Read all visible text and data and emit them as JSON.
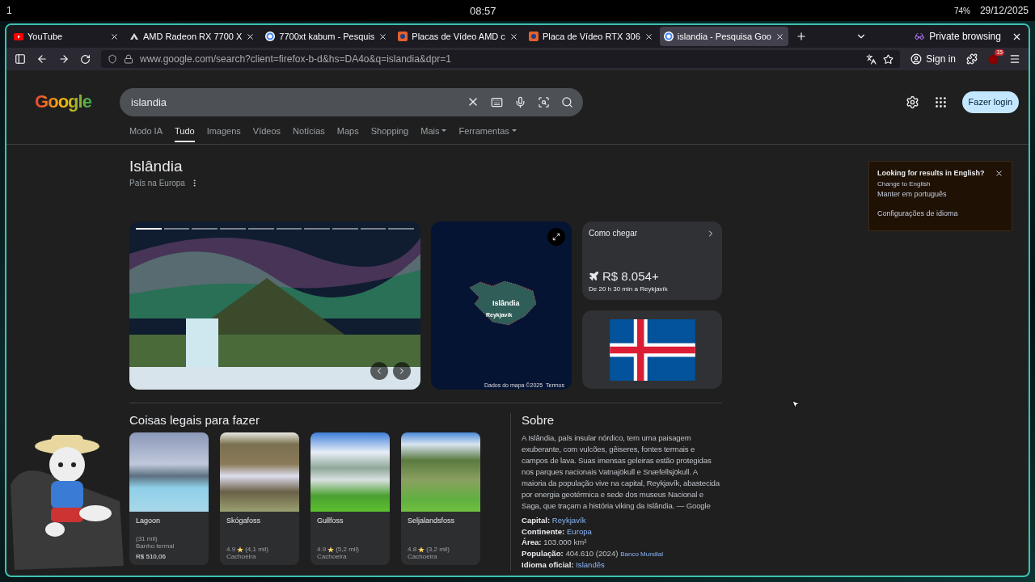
{
  "top_bar": {
    "workspace": "1",
    "clock": "08:57",
    "battery": "74%",
    "date": "29/12/2025"
  },
  "tabs": [
    {
      "title": "YouTube",
      "kind": "youtube",
      "selected": false
    },
    {
      "title": "AMD Radeon RX 7700 X",
      "kind": "amd",
      "selected": false
    },
    {
      "title": "7700xt kabum - Pesquis",
      "kind": "google",
      "selected": false
    },
    {
      "title": "Placas de Vídeo AMD c",
      "kind": "kabum",
      "selected": false
    },
    {
      "title": "Placa de Vídeo RTX 306",
      "kind": "kabum",
      "selected": false
    },
    {
      "title": "islandia - Pesquisa Goo",
      "kind": "google",
      "selected": true
    }
  ],
  "private_label": "Private browsing",
  "toolbar": {
    "url": "www.google.com/search?client=firefox-b-d&hs=DA4o&q=islandia&dpr=1",
    "sign_in": "Sign in",
    "extension_badge": "15"
  },
  "google": {
    "logo": "Google",
    "query": "islandia",
    "login": "Fazer login",
    "nav": [
      {
        "label": "Modo IA",
        "selected": false,
        "dropdown": false
      },
      {
        "label": "Tudo",
        "selected": true,
        "dropdown": false
      },
      {
        "label": "Imagens",
        "selected": false,
        "dropdown": false
      },
      {
        "label": "Vídeos",
        "selected": false,
        "dropdown": false
      },
      {
        "label": "Notícias",
        "selected": false,
        "dropdown": false
      },
      {
        "label": "Maps",
        "selected": false,
        "dropdown": false
      },
      {
        "label": "Shopping",
        "selected": false,
        "dropdown": false
      },
      {
        "label": "Mais",
        "selected": false,
        "dropdown": true
      },
      {
        "label": "Ferramentas",
        "selected": false,
        "dropdown": true
      }
    ]
  },
  "entity": {
    "title": "Islândia",
    "subtitle": "País na Europa",
    "carousel_dots": [
      {
        "selected": true
      },
      {
        "selected": false
      },
      {
        "selected": false
      },
      {
        "selected": false
      },
      {
        "selected": false
      },
      {
        "selected": false
      },
      {
        "selected": false
      },
      {
        "selected": false
      },
      {
        "selected": false
      },
      {
        "selected": false
      }
    ],
    "map": {
      "country": "Islândia",
      "city": "Reykjavík",
      "attribution": "Dados do mapa ©2025",
      "terms": "Termos"
    },
    "travel": {
      "title": "Como chegar",
      "price": "R$ 8.054+",
      "duration": "De 20 h 30 min a Reykjavík"
    }
  },
  "things_to_do": {
    "heading": "Coisas legais para fazer",
    "cards": [
      {
        "title": "Lagoon",
        "reviews": "(31 mil)",
        "category": "Banho termal",
        "price": "R$ 510,06"
      },
      {
        "title": "Skógafoss",
        "rating": "4.9",
        "reviews": "(4,1 mil)",
        "category": "Cachoeira"
      },
      {
        "title": "Gullfoss",
        "rating": "4.9",
        "reviews": "(5,2 mil)",
        "category": "Cachoeira"
      },
      {
        "title": "Seljalandsfoss",
        "rating": "4.8",
        "reviews": "(3,2 mil)",
        "category": "Cachoeira"
      }
    ]
  },
  "about": {
    "heading": "Sobre",
    "text": "A Islândia, país insular nórdico, tem uma paisagem exuberante, com vulcões, gêiseres, fontes termais e campos de lava. Suas imensas geleiras estão protegidas nos parques nacionais Vatnajökull e Snæfellsjökull. A maioria da população vive na capital, Reykjavík, abastecida por energia geotérmica e sede dos museus Nacional e Saga, que traçam a história viking da Islândia. — Google",
    "facts": [
      {
        "label": "Capital:",
        "value": "Reykjavík",
        "link": true
      },
      {
        "label": "Continente:",
        "value": "Europa",
        "link": true
      },
      {
        "label": "Área:",
        "value": "103.000 km²",
        "link": false
      },
      {
        "label": "População:",
        "value": "404.610 (2024)",
        "link": false,
        "source": "Banco Mundial"
      },
      {
        "label": "Idioma oficial:",
        "value": "Islandês",
        "link": true
      }
    ]
  },
  "language_popup": {
    "title": "Looking for results in English?",
    "links": [
      "Change to English",
      "Manter em português",
      "Configurações de idioma"
    ]
  }
}
